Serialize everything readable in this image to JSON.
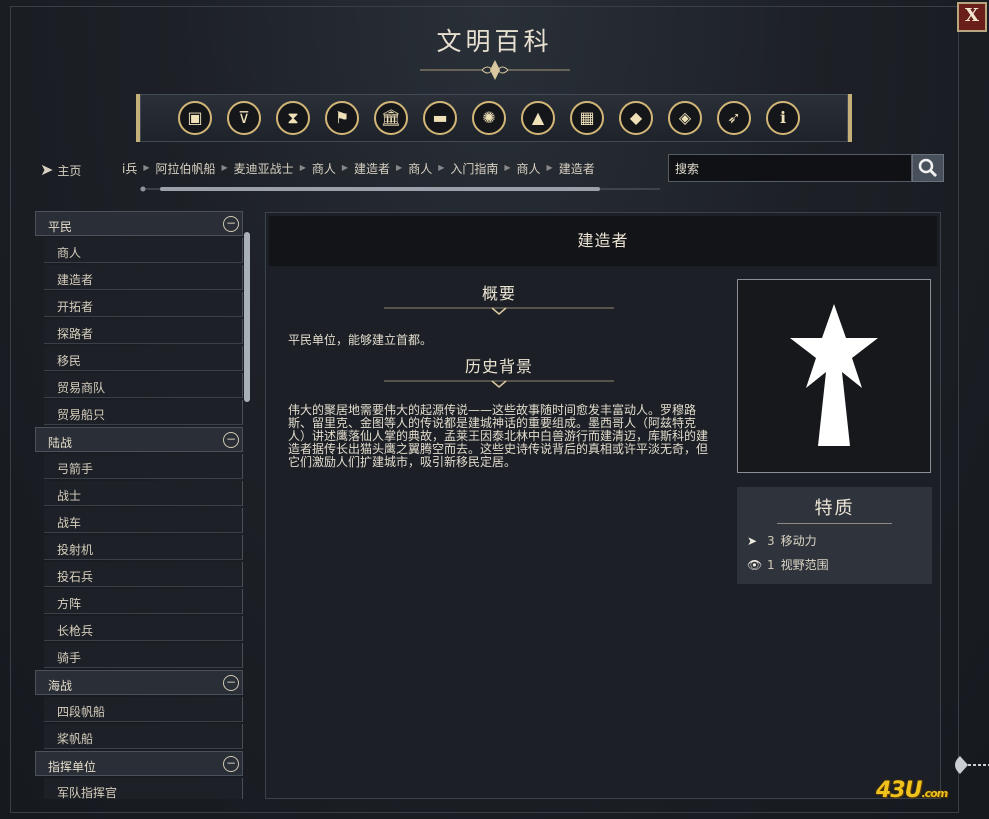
{
  "window": {
    "title": "文明百科",
    "close_label": "X"
  },
  "category_icons": [
    "crate-icon",
    "chalice-icon",
    "hourglass-icon",
    "flag-icon",
    "museum-icon",
    "book-icon",
    "atom-icon",
    "mountain-icon",
    "city-icon",
    "diamond-arrow-icon",
    "split-diamond-icon",
    "bird-icon",
    "info-icon"
  ],
  "category_glyphs": [
    "▣",
    "⊽",
    "⧗",
    "⚑",
    "🏛",
    "▬",
    "✺",
    "▲",
    "▦",
    "◆",
    "◈",
    "➶",
    "ℹ"
  ],
  "home_label": "主页",
  "breadcrumbs": [
    "i兵",
    "阿拉伯帆船",
    "麦迪亚战士",
    "商人",
    "建造者",
    "商人",
    "入门指南",
    "商人",
    "建造者"
  ],
  "search": {
    "placeholder": "搜索"
  },
  "sidebar": {
    "sections": [
      {
        "title": "平民",
        "items": [
          "商人",
          "建造者",
          "开拓者",
          "探路者",
          "移民",
          "贸易商队",
          "贸易船只"
        ]
      },
      {
        "title": "陆战",
        "items": [
          "弓箭手",
          "战士",
          "战车",
          "投射机",
          "投石兵",
          "方阵",
          "长枪兵",
          "骑手"
        ]
      },
      {
        "title": "海战",
        "items": [
          "四段帆船",
          "桨帆船"
        ]
      },
      {
        "title": "指挥单位",
        "items": [
          "军队指挥官"
        ]
      }
    ]
  },
  "content": {
    "title": "建造者",
    "summary_heading": "概要",
    "summary_text": "平民单位，能够建立首都。",
    "history_heading": "历史背景",
    "history_text": "伟大的聚居地需要伟大的起源传说——这些故事随时间愈发丰富动人。罗穆路斯、留里克、金图等人的传说都是建城神话的重要组成。墨西哥人（阿兹特克人）讲述鹰落仙人掌的典故，孟莱王因泰北林中白兽游行而建清迈，库斯科的建造者据传长出猫头鹰之翼腾空而去。这些史诗传说背后的真相或许平淡无奇，但它们激励人们扩建城市，吸引新移民定居。",
    "traits_title": "特质",
    "traits": [
      {
        "icon": "arrow-icon",
        "value": "3",
        "label": "移动力"
      },
      {
        "icon": "eye-icon",
        "value": "1",
        "label": "视野范围"
      }
    ]
  },
  "watermark": {
    "text": "43U",
    "suffix": ".com"
  }
}
